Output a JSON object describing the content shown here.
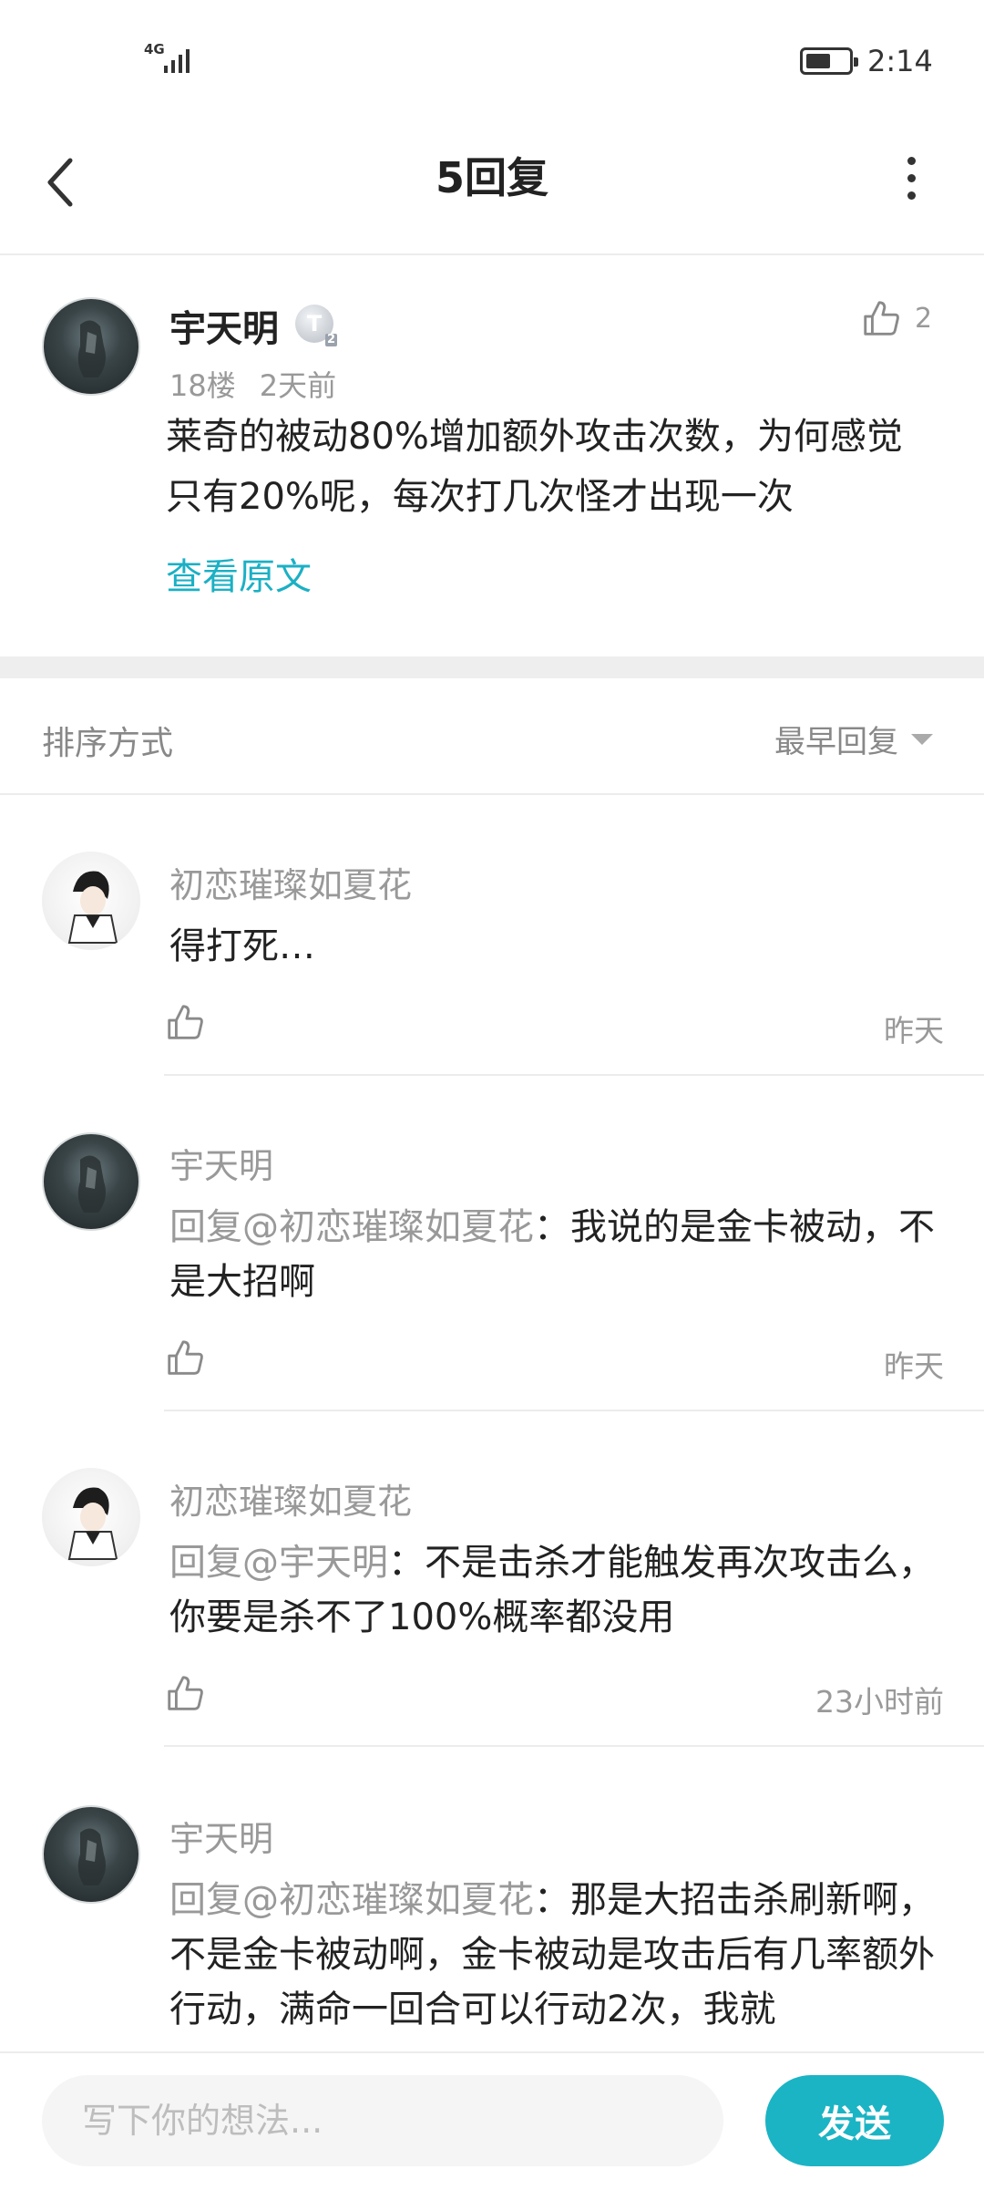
{
  "status_bar": {
    "network": "4G",
    "time": "2:14"
  },
  "header": {
    "title": "5回复"
  },
  "post": {
    "author": "宇天明",
    "badge": "T",
    "badge_level": "2",
    "floor": "18楼",
    "time": "2天前",
    "likes": "2",
    "content": "莱奇的被动80%增加额外攻击次数，为何感觉只有20%呢，每次打几次怪才出现一次",
    "view_original": "查看原文"
  },
  "sort": {
    "label": "排序方式",
    "selected": "最早回复"
  },
  "replies": [
    {
      "author": "初恋璀璨如夏花",
      "mention": "",
      "text": "得打死…",
      "time": "昨天"
    },
    {
      "author": "宇天明",
      "mention": "回复@初恋璀璨如夏花",
      "text": "：我说的是金卡被动，不是大招啊",
      "time": "昨天"
    },
    {
      "author": "初恋璀璨如夏花",
      "mention": "回复@宇天明",
      "text": "：不是击杀才能触发再次攻击么，你要是杀不了100%概率都没用",
      "time": "23小时前"
    },
    {
      "author": "宇天明",
      "mention": "回复@初恋璀璨如夏花",
      "text": "：那是大招击杀刷新啊，不是金卡被动啊，金卡被动是攻击后有几率额外行动，满命一回合可以行动2次，我就",
      "time": ""
    }
  ],
  "composer": {
    "placeholder": "写下你的想法...",
    "send_label": "发送"
  },
  "colors": {
    "accent": "#1bb4c4",
    "link": "#1bb0c4"
  }
}
